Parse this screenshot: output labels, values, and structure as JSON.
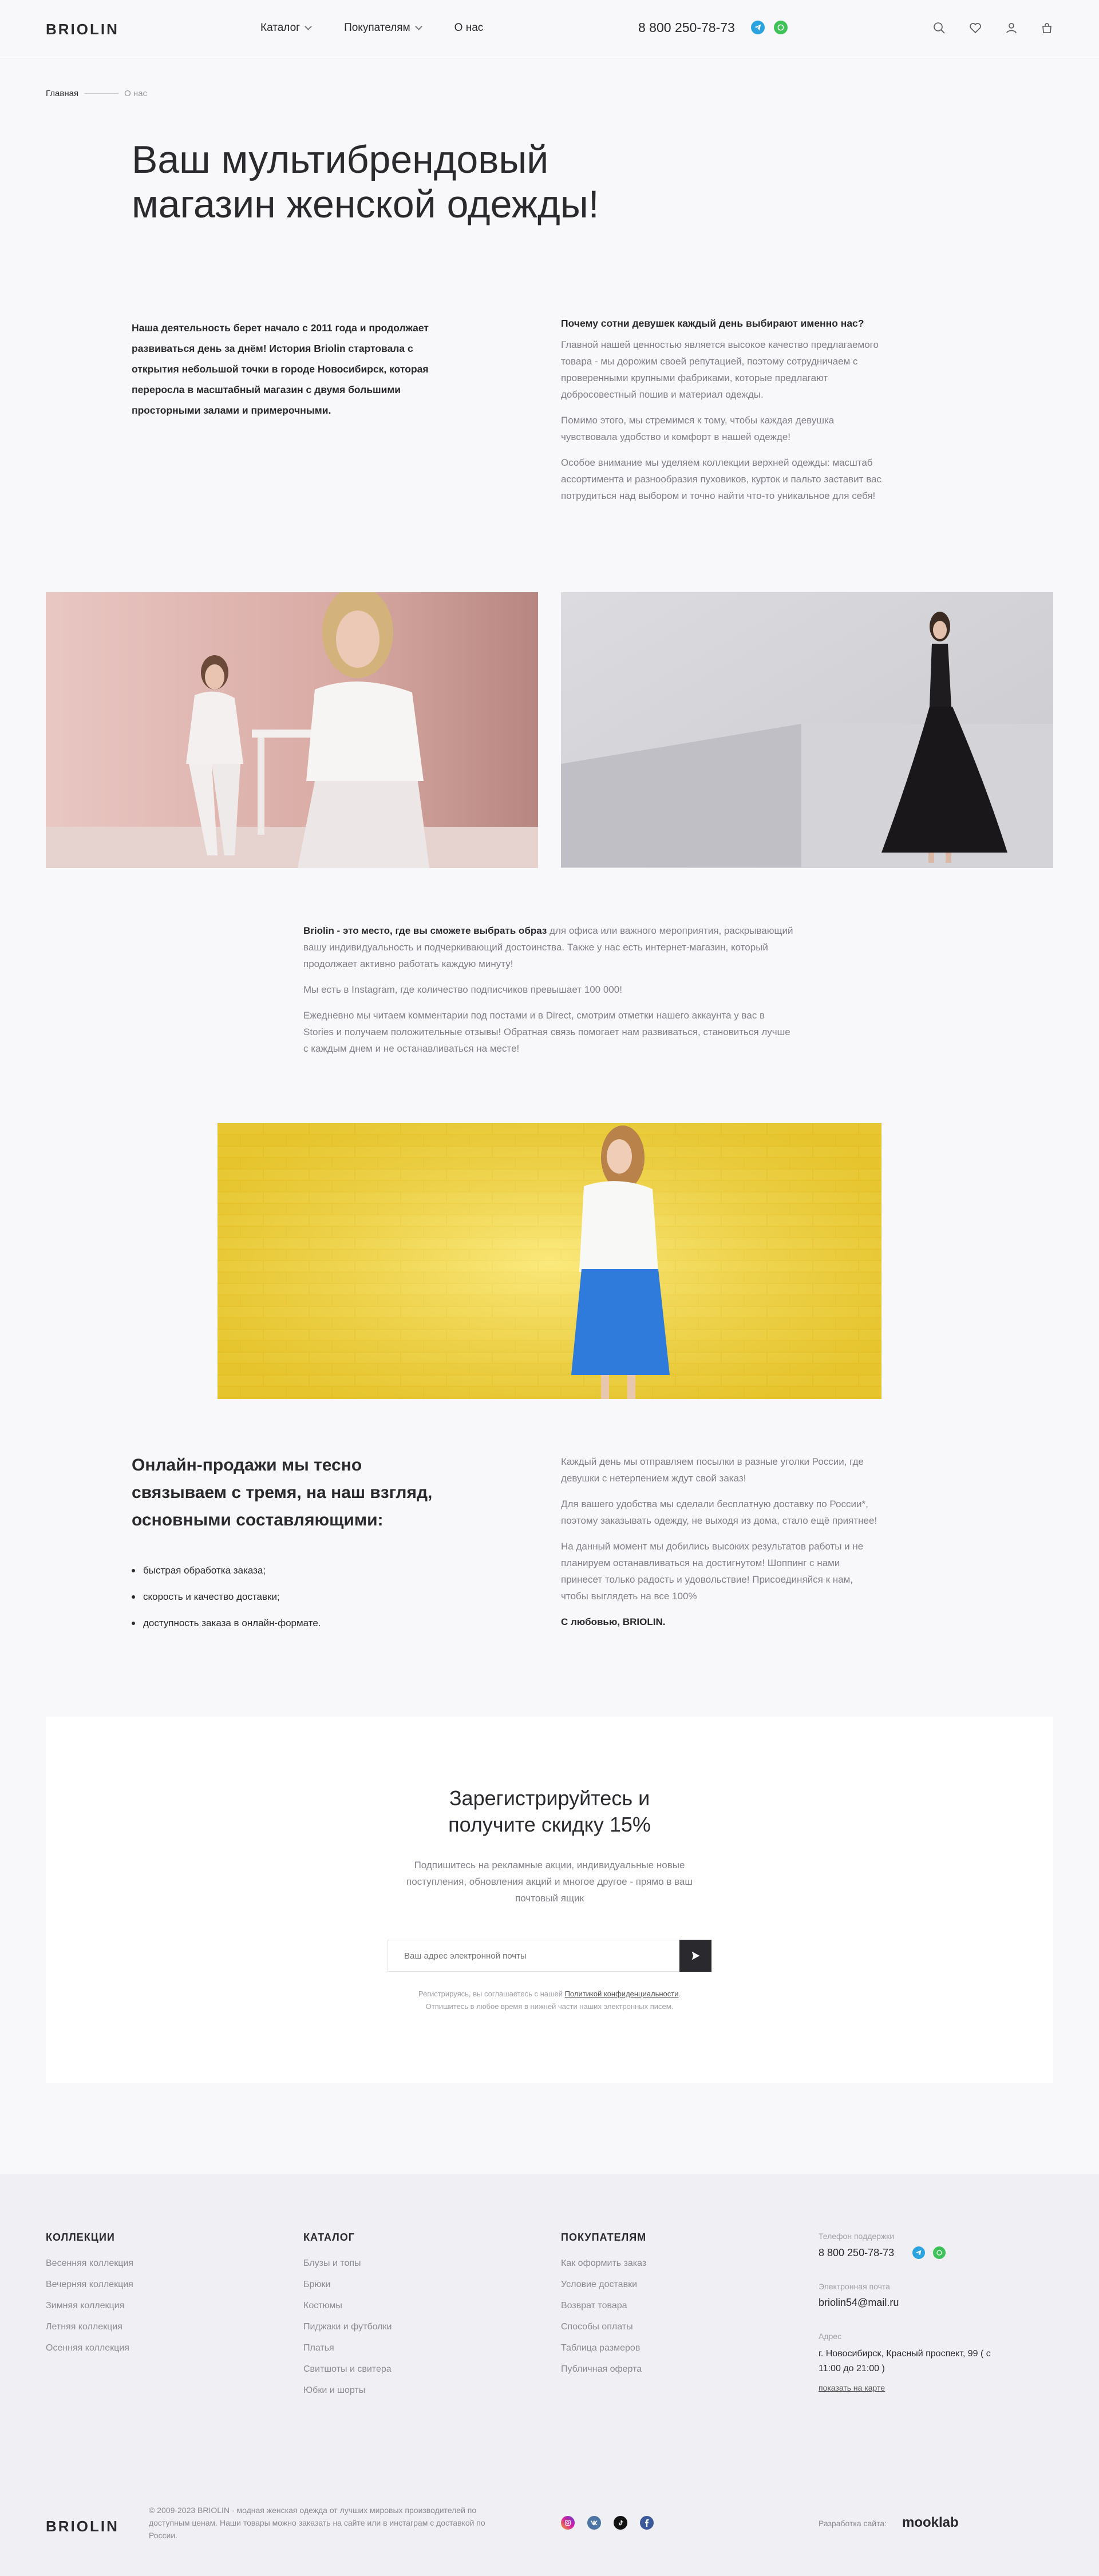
{
  "header": {
    "logo": "BRIOLIN",
    "nav": [
      {
        "label": "Каталог",
        "dropdown": true
      },
      {
        "label": "Покупателям",
        "dropdown": true
      },
      {
        "label": "О нас",
        "dropdown": false
      }
    ],
    "phone": "8 800 250-78-73",
    "icons": [
      "telegram-icon",
      "whatsapp-icon",
      "search-icon",
      "heart-icon",
      "user-icon",
      "cart-icon"
    ]
  },
  "breadcrumb": {
    "home": "Главная",
    "current": "О нас"
  },
  "page_title": "Ваш мультибрендовый магазин женской одежды!",
  "intro": {
    "left": "Наша деятельность берет начало с 2011 года и продолжает развиваться день за днём! История Briolin стартовала с открытия небольшой точки в городе Новосибирск, которая переросла в масштабный магазин с двумя большими просторными залами и примерочными.",
    "right_title": "Почему сотни девушек каждый день выбирают именно нас?",
    "right_paragraphs": [
      "Главной нашей ценностью является высокое качество предлагаемого товара - мы дорожим своей репутацией, поэтому сотрудничаем с проверенными крупными фабриками, которые предлагают добросовестный пошив и материал одежды.",
      "Помимо этого, мы стремимся к тому, чтобы каждая девушка чувствовала удобство и комфорт в нашей одежде!",
      "Особое внимание мы уделяем коллекции верхней одежды: масштаб ассортимента и разнообразия пуховиков, курток и пальто заставит вас потрудиться над выбором и точно найти что-то уникальное для себя!"
    ]
  },
  "mid": {
    "lead_bold": "Briolin - это место, где вы сможете выбрать образ",
    "lead_rest": " для офиса или важного мероприятия, раскрывающий вашу индивидуальность и подчеркивающий достоинства. Также у нас есть интернет-магазин, который продолжает активно работать каждую минуту!",
    "p2": "Мы есть в Instagram, где количество подписчиков превышает 100 000!",
    "p3": "Ежедневно мы читаем комментарии под постами и в Direct, смотрим отметки нашего аккаунта у вас в Stories и получаем положительные отзывы! Обратная связь помогает нам развиваться, становиться лучше с каждым днем и не останавливаться на месте!"
  },
  "sales": {
    "title": "Онлайн-продажи мы тесно связываем с тремя, на наш взгляд, основными составляющими:",
    "items": [
      "быстрая обработка заказа;",
      "скорость и качество доставки;",
      "доступность заказа в онлайн-формате."
    ],
    "right_paragraphs": [
      "Каждый день мы отправляем посылки в разные уголки России, где девушки с нетерпением ждут свой заказ!",
      "Для вашего удобства мы сделали бесплатную доставку по России*, поэтому заказывать одежду, не выходя из дома, стало ещё приятнее!",
      "На данный момент мы добились высоких результатов работы и не планируем останавливаться на достигнутом! Шоппинг с нами принесет только радость и удовольствие! Присоединяйся к нам, чтобы выглядеть на все 100%"
    ],
    "signature": "С любовью, BRIOLIN."
  },
  "subscribe": {
    "title": "Зарегистрируйтесь и получите скидку 15%",
    "text": "Подпишитесь на рекламные акции, индивидуальные новые поступления, обновления акций и многое другое - прямо в ваш почтовый ящик",
    "placeholder": "Ваш адрес электронной почты",
    "note_before": "Регистрируясь, вы соглашаетесь с нашей ",
    "note_link": "Политикой конфиденциальности",
    "note_after": ".",
    "note_line2": "Отпишитесь в любое время в нижней части наших электронных писем."
  },
  "footer": {
    "collections": {
      "title": "КОЛЛЕКЦИИ",
      "links": [
        "Весенняя коллекция",
        "Вечерняя коллекция",
        "Зимняя коллекция",
        "Летняя коллекция",
        "Осенняя коллекция"
      ]
    },
    "catalog": {
      "title": "КАТАЛОГ",
      "links": [
        "Блузы и топы",
        "Брюки",
        "Костюмы",
        "Пиджаки и футболки",
        "Платья",
        "Свитшоты и свитера",
        "Юбки и шорты"
      ]
    },
    "customers": {
      "title": "ПОКУПАТЕЛЯМ",
      "links": [
        "Как оформить заказ",
        "Условие доставки",
        "Возврат товара",
        "Способы оплаты",
        "Таблица размеров",
        "Публичная оферта"
      ]
    },
    "contact": {
      "phone_label": "Телефон поддержки",
      "phone": "8 800 250-78-73",
      "email_label": "Электронная почта",
      "email": "briolin54@mail.ru",
      "address_label": "Адрес",
      "address": "г. Новосибирск, Красный проспект, 99 ( с 11:00 до 21:00 )",
      "map_link": "показать на карте"
    },
    "logo": "BRIOLIN",
    "copyright": "© 2009-2023 BRIOLIN - модная женская одежда от лучших мировых производителей по доступным ценам. Наши товары можно заказать на сайте или в инстаграм с доставкой по России.",
    "social": [
      "instagram-icon",
      "vk-icon",
      "tiktok-icon",
      "facebook-icon"
    ],
    "developer_label": "Разработка сайта:",
    "developer": "mooklab"
  },
  "colors": {
    "accent": "#2a2a2e",
    "telegram": "#2aa3df",
    "whatsapp": "#3fc25a",
    "background": "#f8f8fa"
  }
}
